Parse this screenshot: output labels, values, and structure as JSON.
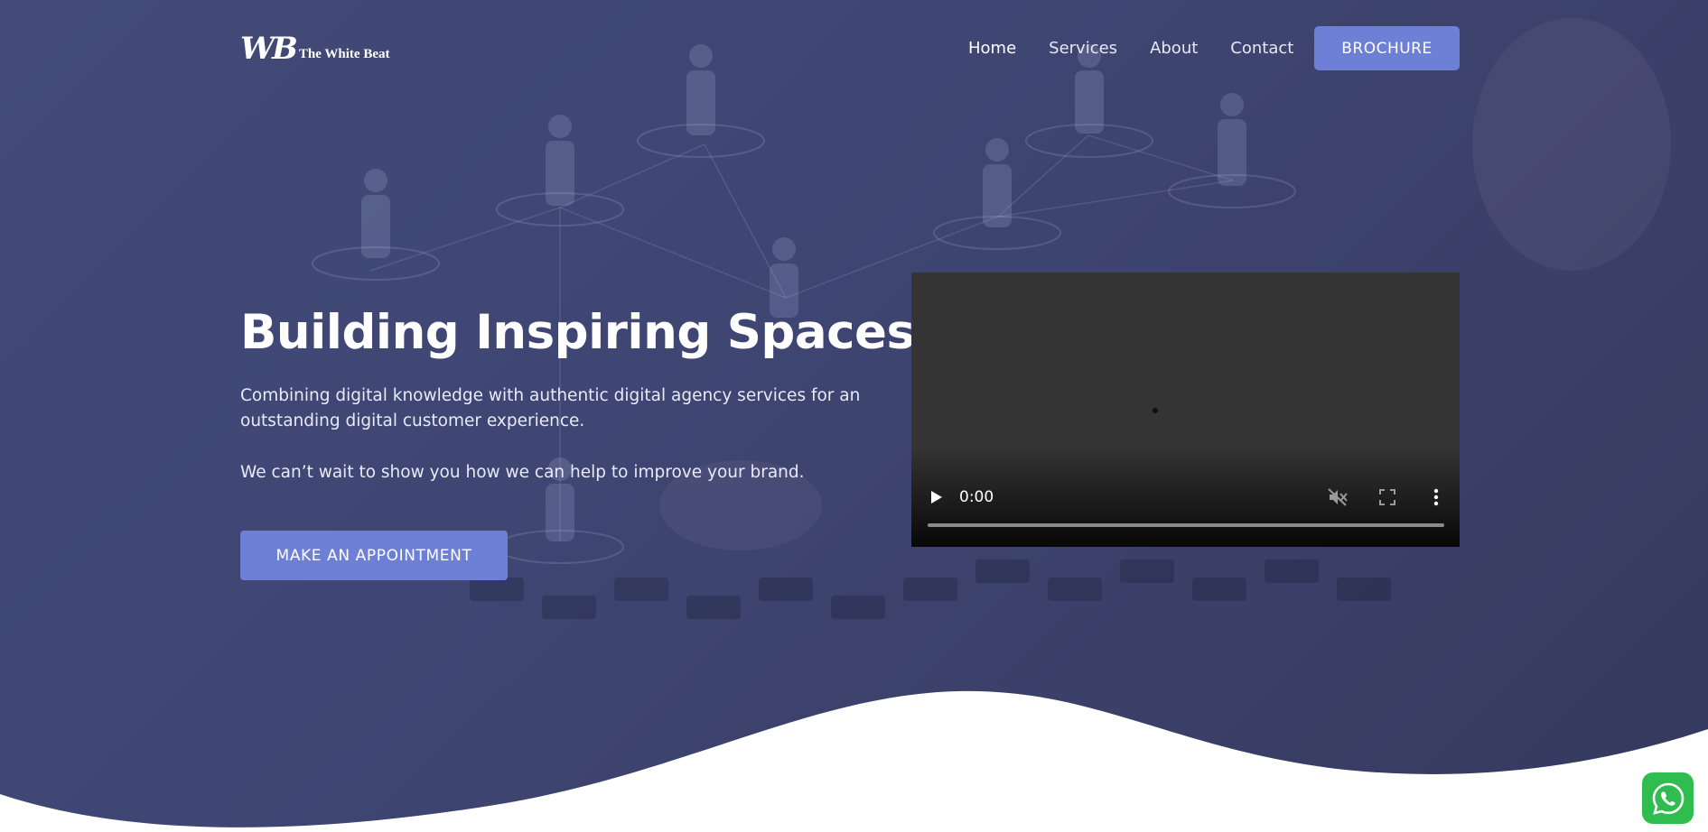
{
  "brand": {
    "logo_mark": "WB",
    "name": "The White Beat"
  },
  "nav": {
    "items": [
      {
        "label": "Home",
        "active": true
      },
      {
        "label": "Services",
        "active": false
      },
      {
        "label": "About",
        "active": false
      },
      {
        "label": "Contact",
        "active": false
      }
    ],
    "cta_label": "BROCHURE"
  },
  "hero": {
    "headline": "Building Inspiring Spaces",
    "paragraph_1": "Combining digital knowledge with authentic digital agency services for an outstanding digital customer experience.",
    "paragraph_2": "We can’t wait to show you how we can help to improve your brand.",
    "cta_label": "MAKE AN APPOINTMENT"
  },
  "video": {
    "time": "0:00",
    "progress": 0,
    "controls": [
      "play-icon",
      "mute-icon",
      "fullscreen-icon",
      "more-vertical-icon"
    ]
  },
  "floating": {
    "whatsapp_icon": "whatsapp-icon"
  },
  "colors": {
    "accent": "#6e7fd6",
    "hero_overlay": "#3f4673",
    "video_bg": "#343434",
    "whatsapp": "#2fbd4f"
  }
}
